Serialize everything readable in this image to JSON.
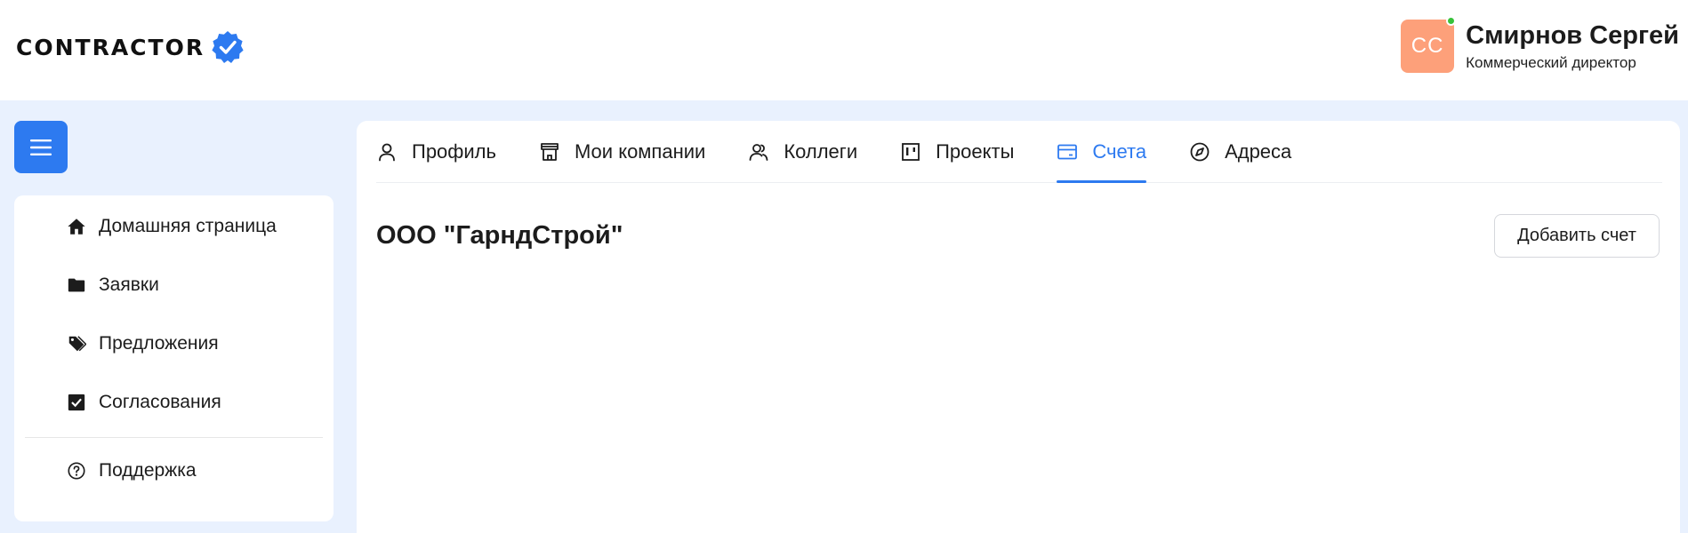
{
  "header": {
    "logo_text": "CONTRACTOR",
    "user": {
      "initials": "СС",
      "name": "Смирнов Сергей",
      "role": "Коммерческий директор",
      "status": "online"
    }
  },
  "sidebar": {
    "items": [
      {
        "label": "Домашняя страница",
        "icon": "home-icon"
      },
      {
        "label": "Заявки",
        "icon": "folder-icon"
      },
      {
        "label": "Предложения",
        "icon": "tags-icon"
      },
      {
        "label": "Согласования",
        "icon": "checkbox-icon"
      }
    ],
    "support": {
      "label": "Поддержка",
      "icon": "question-circle-icon"
    }
  },
  "tabs": [
    {
      "label": "Профиль",
      "icon": "user-icon",
      "active": false
    },
    {
      "label": "Мои компании",
      "icon": "store-icon",
      "active": false
    },
    {
      "label": "Коллеги",
      "icon": "users-icon",
      "active": false
    },
    {
      "label": "Проекты",
      "icon": "kanban-icon",
      "active": false
    },
    {
      "label": "Счета",
      "icon": "credit-card-icon",
      "active": true
    },
    {
      "label": "Адреса",
      "icon": "compass-icon",
      "active": false
    }
  ],
  "content": {
    "company_name": "ООО \"ГарндСтрой\"",
    "add_button_label": "Добавить счет"
  },
  "colors": {
    "accent": "#2d7af0",
    "page_background": "#e9f1fe",
    "avatar": "#fda07a",
    "online": "#37c23a"
  }
}
